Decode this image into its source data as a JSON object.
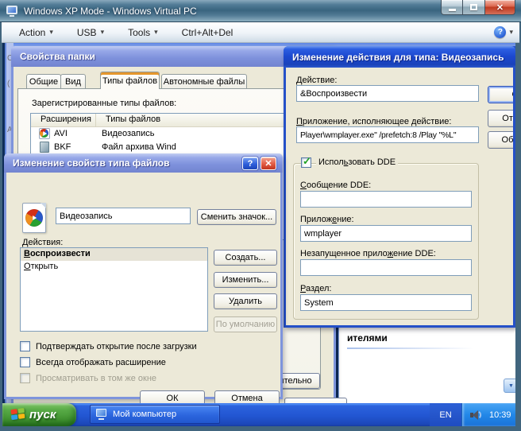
{
  "icons": {
    "dropdown": "▾",
    "help_glyph": "?",
    "close_glyph": "✕",
    "check_glyph": "✓",
    "scroll_down_glyph": "▼"
  },
  "colors": {
    "luna_active_title": "#1c48cf",
    "luna_inactive_title": "#7e91dc",
    "dialog_bg": "#ece9d8",
    "tab_highlight": "#e5962c",
    "taskbar_blue": "#2256d2",
    "tray_blue": "#2288e8",
    "start_green": "#3f912f",
    "vpc_frame": "#39647f"
  },
  "vpc": {
    "title": "Windows XP Mode - Windows Virtual PC",
    "menu": {
      "action": "Action",
      "usb": "USB",
      "tools": "Tools",
      "ctrl_alt_del": "Ctrl+Alt+Del"
    }
  },
  "folder_options": {
    "title": "Свойства папки",
    "tabs": {
      "general": "Общие",
      "view": "Вид",
      "file_types": "Типы файлов",
      "offline": "Автономные файлы"
    },
    "registered_label": "Зарегистрированные типы файлов:",
    "col_ext": "Расширения",
    "col_type": "Типы файлов",
    "rows": [
      {
        "ext": "AVI",
        "type": "Видеозапись"
      },
      {
        "ext": "BKF",
        "type": "Файл архива Wind"
      }
    ],
    "advanced_button": "Дополнительно"
  },
  "edit_action": {
    "title": "Изменение действия для типа: Видеозапись",
    "action_label": {
      "pre": "",
      "u": "Д",
      "post": "ействие:"
    },
    "action_value": "&Воспроизвести",
    "app_label": {
      "pre": "",
      "u": "П",
      "post": "риложение, исполняющее действие:"
    },
    "app_value": "Player\\wmplayer.exe\" /prefetch:8 /Play \"%L\"",
    "ok": "ОК",
    "cancel": "Отмена",
    "browse": "Обзор...",
    "use_dde": {
      "pre": "Испол",
      "u": "ь",
      "post": "зовать DDE"
    },
    "dde_checked": true,
    "msg_label": {
      "pre": "",
      "u": "С",
      "post": "ообщение DDE:"
    },
    "msg_value": "",
    "app2_label": {
      "pre": "Прилож",
      "u": "е",
      "post": "ние:"
    },
    "app2_value": "wmplayer",
    "notrun_label": {
      "pre": "Незапущенное прило",
      "u": "ж",
      "post": "ение DDE:"
    },
    "notrun_value": "",
    "topic_label": {
      "pre": "",
      "u": "Р",
      "post": "аздел:"
    },
    "topic_value": "System"
  },
  "edit_type": {
    "title": "Изменение свойств типа файлов",
    "name_value": "Видеозапись",
    "change_icon": "Сменить значок...",
    "actions_label": "Действия:",
    "actions": [
      {
        "pre": "",
        "u": "В",
        "post": "оспроизвести"
      },
      {
        "pre": "",
        "u": "О",
        "post": "ткрыть"
      }
    ],
    "new_btn": "Создать...",
    "edit_btn": "Изменить...",
    "delete_btn": "Удалить",
    "default_btn": "По умолчанию",
    "confirm_open": "Подтверждать открытие после загрузки",
    "always_ext": "Всегда отображать расширение",
    "same_window": "Просматривать в том же окне",
    "ok": "ОК",
    "cancel": "Отмена"
  },
  "background_window": {
    "heading_fragment": "ителями",
    "left_fragments": [
      "С",
      "(",
      "А"
    ]
  },
  "taskbar": {
    "start": "пуск",
    "task": "Мой компьютер",
    "lang": "EN",
    "time": "10:39"
  }
}
